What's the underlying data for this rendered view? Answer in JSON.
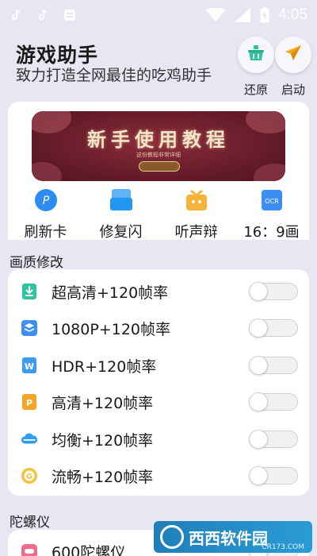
{
  "status_bar": {
    "time": "4:05"
  },
  "header": {
    "title": "游戏助手",
    "subtitle": "致力打造全网最佳的吃鸡助手",
    "restore_label": "还原",
    "launch_label": "启动"
  },
  "banner": {
    "title": "新手使用教程",
    "subtitle": "这份教程非常详细"
  },
  "quick_actions": [
    {
      "label": "刷新卡",
      "icon": "refresh-card-icon",
      "color": "#2c8cf0"
    },
    {
      "label": "修复闪",
      "icon": "repair-icon",
      "color": "#2196f3"
    },
    {
      "label": "听声辩",
      "icon": "sound-gift-icon",
      "color": "#f4b43a"
    },
    {
      "label": "16：9画",
      "icon": "ocr-icon",
      "color": "#3b8ef2"
    }
  ],
  "quality_section": {
    "title": "画质修改",
    "items": [
      {
        "label": "超高清+120帧率",
        "icon": "download-icon",
        "color": "#2ec4a0",
        "enabled": false
      },
      {
        "label": "1080P+120帧率",
        "icon": "layers-icon",
        "color": "#3d8ff5",
        "enabled": false
      },
      {
        "label": "HDR+120帧率",
        "icon": "doc-w-icon",
        "color": "#3d9af5",
        "enabled": false
      },
      {
        "label": "高清+120帧率",
        "icon": "doc-p-icon",
        "color": "#f5a623",
        "enabled": false
      },
      {
        "label": "均衡+120帧率",
        "icon": "cloud-icon",
        "color": "#2f9ef0",
        "enabled": false
      },
      {
        "label": "流畅+120帧率",
        "icon": "coin-g-icon",
        "color": "#f3c23a",
        "enabled": false
      }
    ]
  },
  "gyro_section": {
    "title": "陀螺仪",
    "items": [
      {
        "label": "600陀螺仪",
        "icon": "gyro-icon",
        "color": "#f06b8a",
        "enabled": false
      }
    ]
  },
  "watermark": {
    "text": "西西软件园",
    "url": "CR173.COM"
  }
}
